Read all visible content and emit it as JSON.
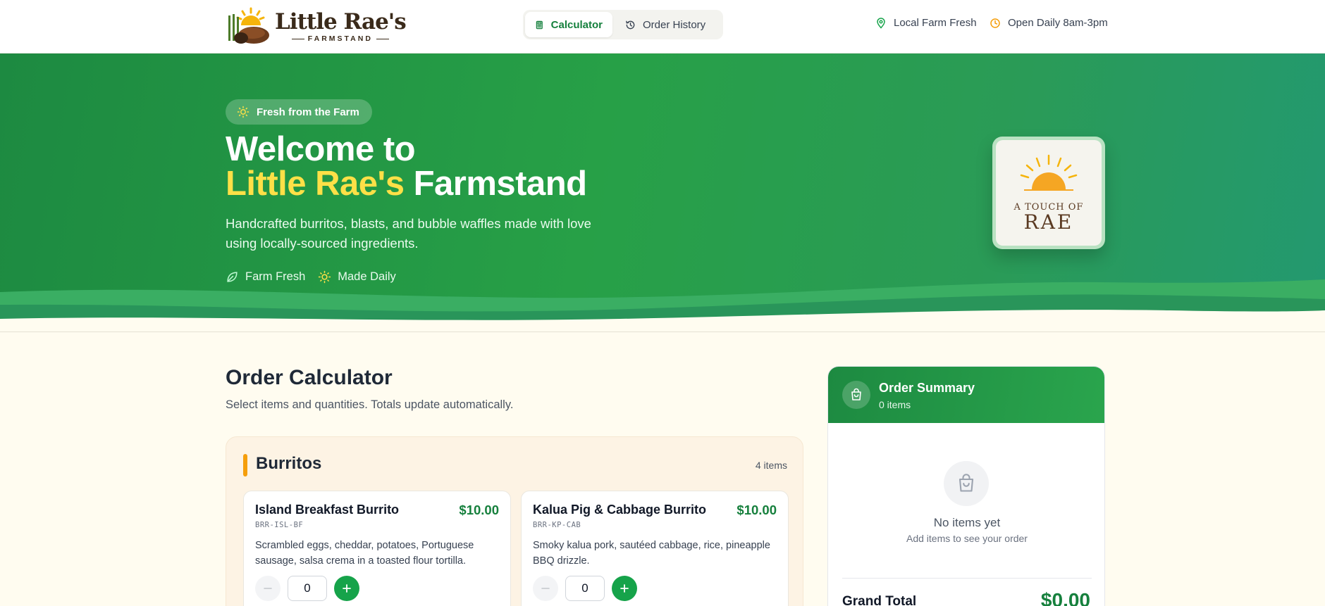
{
  "brand": {
    "name": "Little Rae's",
    "tagline": "FARMSTAND"
  },
  "nav": {
    "tabs": [
      {
        "label": "Calculator",
        "icon": "calculator-icon",
        "active": true
      },
      {
        "label": "Order History",
        "icon": "history-icon",
        "active": false
      }
    ],
    "info": [
      {
        "label": "Local Farm Fresh",
        "icon": "map-pin-icon"
      },
      {
        "label": "Open Daily 8am-3pm",
        "icon": "clock-icon"
      }
    ]
  },
  "hero": {
    "badge": "Fresh from the Farm",
    "title_line1": "Welcome to",
    "title_brand": "Little Rae's",
    "title_rest": " Farmstand",
    "description": "Handcrafted burritos, blasts, and bubble waffles made with love using locally-sourced ingredients.",
    "features": [
      {
        "label": "Farm Fresh",
        "icon": "leaf-icon"
      },
      {
        "label": "Made Daily",
        "icon": "sun-icon"
      }
    ],
    "card": {
      "line1": "A TOUCH OF",
      "line2": "RAE"
    }
  },
  "calculator": {
    "title": "Order Calculator",
    "subtitle": "Select items and quantities. Totals update automatically.",
    "category": {
      "name": "Burritos",
      "count": "4 items",
      "items": [
        {
          "name": "Island Breakfast Burrito",
          "price": "$10.00",
          "sku": "BRR-ISL-BF",
          "description": "Scrambled eggs, cheddar, potatoes, Portuguese sausage, salsa crema in a toasted flour tortilla.",
          "quantity": "0"
        },
        {
          "name": "Kalua Pig & Cabbage Burrito",
          "price": "$10.00",
          "sku": "BRR-KP-CAB",
          "description": "Smoky kalua pork, sautéed cabbage, rice, pineapple BBQ drizzle.",
          "quantity": "0"
        }
      ]
    }
  },
  "summary": {
    "title": "Order Summary",
    "count": "0 items",
    "empty_title": "No items yet",
    "empty_sub": "Add items to see your order",
    "grand_total_label": "Grand Total",
    "grand_total_value": "$0.00"
  },
  "colors": {
    "primary": "#16a34a",
    "hero_start": "#1d8a41",
    "hero_end": "#239970",
    "brand_accent": "#fde047",
    "category_bar": "#f59e0b",
    "page_bg": "#fffcf0"
  }
}
